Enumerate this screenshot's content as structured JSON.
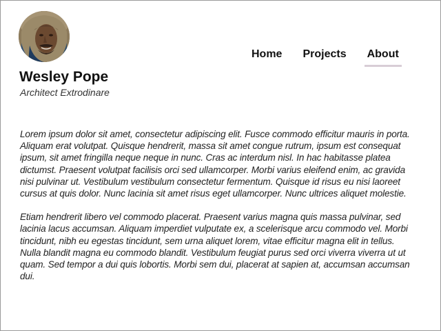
{
  "profile": {
    "avatar_icon": "portrait-photo",
    "name": "Wesley Pope",
    "subtitle": "Architect Extrodinare"
  },
  "nav": {
    "items": [
      {
        "label": "Home",
        "active": false
      },
      {
        "label": "Projects",
        "active": false
      },
      {
        "label": "About",
        "active": true
      }
    ],
    "active_underline_color": "#d8cdd6"
  },
  "content": {
    "paragraphs": [
      "Lorem ipsum dolor sit amet, consectetur adipiscing elit. Fusce commodo efficitur mauris in porta. Aliquam erat volutpat. Quisque hendrerit, massa sit amet congue rutrum, ipsum est consequat ipsum, sit amet fringilla neque neque in nunc. Cras ac interdum nisl. In hac habitasse platea dictumst. Praesent volutpat facilisis orci sed ullamcorper. Morbi varius eleifend enim, ac gravida nisi pulvinar ut. Vestibulum vestibulum consectetur fermentum. Quisque id risus eu nisi laoreet cursus at quis dolor. Nunc lacinia sit amet risus eget ullamcorper. Nunc ultrices aliquet molestie.",
      "Etiam hendrerit libero vel commodo placerat. Praesent varius magna quis massa pulvinar, sed lacinia lacus accumsan. Aliquam imperdiet vulputate ex, a scelerisque arcu commodo vel. Morbi tincidunt, nibh eu egestas tincidunt, sem urna aliquet lorem, vitae efficitur magna elit in tellus. Nulla blandit magna eu commodo blandit. Vestibulum feugiat purus sed orci viverra viverra ut ut quam. Sed tempor a dui quis lobortis. Morbi sem dui, placerat at sapien at, accumsan accumsan dui."
    ]
  }
}
